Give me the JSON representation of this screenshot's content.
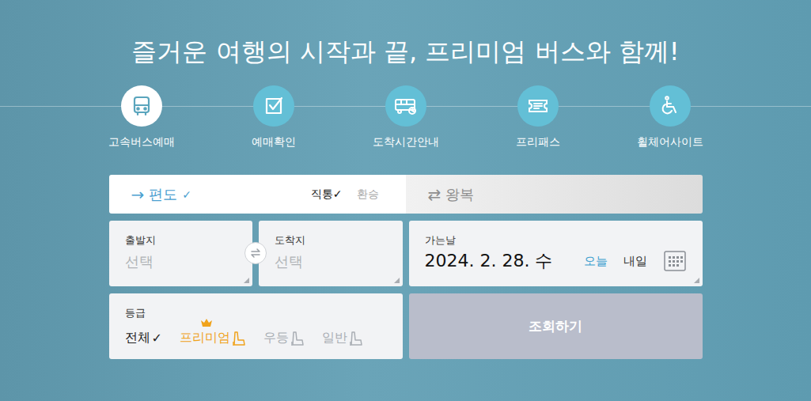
{
  "title": "즐거운 여행의 시작과 끝, 프리미엄 버스와 함께!",
  "menu": [
    {
      "label": "고속버스예매",
      "selected": true
    },
    {
      "label": "예매확인",
      "selected": false
    },
    {
      "label": "도착시간안내",
      "selected": false
    },
    {
      "label": "프리패스",
      "selected": false
    },
    {
      "label": "휠체어사이트",
      "selected": false
    }
  ],
  "trip_type": [
    {
      "label": "편도",
      "symbol": "→",
      "selected": true
    },
    {
      "label": "왕복",
      "symbol": "⇄",
      "selected": false
    }
  ],
  "route_type": [
    {
      "label": "직통",
      "selected": true
    },
    {
      "label": "환승",
      "selected": false
    }
  ],
  "check_mark": "✓",
  "departure": {
    "label": "출발지",
    "placeholder": "선택"
  },
  "arrival": {
    "label": "도착지",
    "placeholder": "선택"
  },
  "date": {
    "label": "가는날",
    "value": "2024. 2. 28. 수",
    "shortcuts": [
      {
        "label": "오늘",
        "selected": true
      },
      {
        "label": "내일",
        "selected": false
      }
    ]
  },
  "grade": {
    "label": "등급",
    "options": [
      {
        "label": "전체",
        "kind": "plain",
        "selected": true,
        "featured": false,
        "color": "#222222"
      },
      {
        "label": "프리미엄",
        "kind": "seat",
        "selected": false,
        "featured": true,
        "color": "#f0a31c"
      },
      {
        "label": "우등",
        "kind": "seat",
        "selected": false,
        "featured": false,
        "color": "#a9aeb4"
      },
      {
        "label": "일반",
        "kind": "seat",
        "selected": false,
        "featured": false,
        "color": "#a9aeb4"
      }
    ]
  },
  "search_button": {
    "label": "조회하기",
    "disabled": true
  }
}
